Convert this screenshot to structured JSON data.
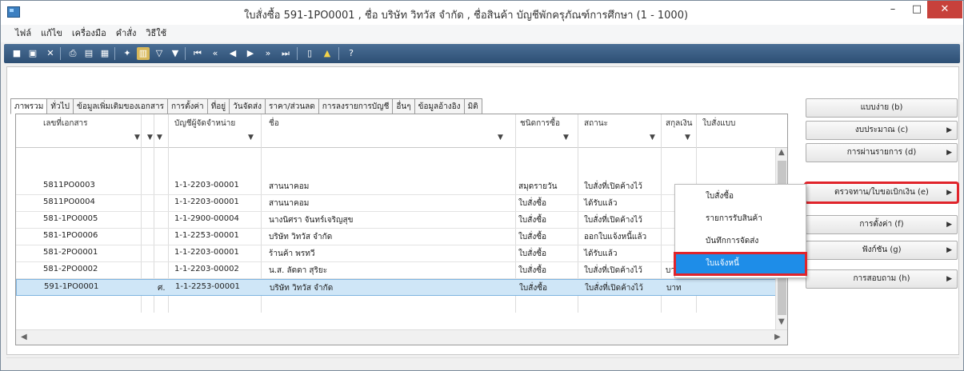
{
  "window": {
    "title": "ใบสั่งซื้อ 591-1PO0001 , ชื่อ บริษัท วิทวัส จำกัด , ชื่อสินค้า บัญชีพักครุภัณฑ์การศึกษา (1 - 1000)",
    "min": "–",
    "max": "□",
    "close": "✕"
  },
  "menu": [
    "ไฟล์",
    "แก้ไข",
    "เครื่องมือ",
    "คำสั่ง",
    "วิธีใช้"
  ],
  "tabs": [
    "ภาพรวม",
    "ทั่วไป",
    "ข้อมูลเพิ่มเติมของเอกสาร",
    "การตั้งค่า",
    "ที่อยู่",
    "วันจัดส่ง",
    "ราคา/ส่วนลด",
    "การลงรายการบัญชี",
    "อื่นๆ",
    "ข้อมูลอ้างอิง",
    "มิติ"
  ],
  "grid": {
    "headers": {
      "doc_no": "เลขที่เอกสาร",
      "vendor_account": "บัญชีผู้จัดจำหน่าย",
      "name": "ชื่อ",
      "purchase_type": "ชนิดการซื้อ",
      "status": "สถานะ",
      "currency": "สกุลเงิน",
      "po_type": "ใบสั่งแบบ"
    },
    "filter_arrow": "▼",
    "rows": [
      {
        "doc_no": "5811PO0003",
        "mark": "",
        "vendor_account": "1-1-2203-00001",
        "name": "สานนาคอม",
        "purchase_type": "สมุดรายวัน",
        "status": "ใบสั่งที่เปิดค้างไว้",
        "currency": "",
        "selected": false
      },
      {
        "doc_no": "5811PO0004",
        "mark": "",
        "vendor_account": "1-1-2203-00001",
        "name": "สานนาคอม",
        "purchase_type": "ใบสั่งซื้อ",
        "status": "ได้รับแล้ว",
        "currency": "",
        "selected": false
      },
      {
        "doc_no": "581-1PO0005",
        "mark": "",
        "vendor_account": "1-1-2900-00004",
        "name": "นางนิศรา จันทร์เจริญสุข",
        "purchase_type": "ใบสั่งซื้อ",
        "status": "ใบสั่งที่เปิดค้างไว้",
        "currency": "",
        "selected": false
      },
      {
        "doc_no": "581-1PO0006",
        "mark": "",
        "vendor_account": "1-1-2253-00001",
        "name": "บริษัท วิทวัส จำกัด",
        "purchase_type": "ใบสั่งซื้อ",
        "status": "ออกใบแจ้งหนี้แล้ว",
        "currency": "",
        "selected": false
      },
      {
        "doc_no": "581-2PO0001",
        "mark": "",
        "vendor_account": "1-1-2203-00001",
        "name": "ร้านค้า พรทวี",
        "purchase_type": "ใบสั่งซื้อ",
        "status": "ได้รับแล้ว",
        "currency": "",
        "selected": false
      },
      {
        "doc_no": "581-2PO0002",
        "mark": "",
        "vendor_account": "1-1-2203-00002",
        "name": "น.ส. ลัดดา สุริยะ",
        "purchase_type": "ใบสั่งซื้อ",
        "status": "ใบสั่งที่เปิดค้างไว้",
        "currency": "บาท",
        "selected": false
      },
      {
        "doc_no": "591-1PO0001",
        "mark": "ศ.",
        "vendor_account": "1-1-2253-00001",
        "name": "บริษัท วิทวัส จำกัด",
        "purchase_type": "ใบสั่งซื้อ",
        "status": "ใบสั่งที่เปิดค้างไว้",
        "currency": "บาท",
        "selected": true
      }
    ]
  },
  "side_buttons": [
    {
      "label": "แบบง่าย (b)",
      "arrow": ""
    },
    {
      "label": "งบประมาณ (c)",
      "arrow": "▶"
    },
    {
      "label": "การผ่านรายการ (d)",
      "arrow": "▶"
    },
    {
      "label": "ตรวจทาน/ใบขอเบิกเงิน (e)",
      "arrow": "▶"
    },
    {
      "label": "การตั้งค่า (f)",
      "arrow": "▶"
    },
    {
      "label": "ฟังก์ชัน (g)",
      "arrow": "▶"
    },
    {
      "label": "การสอบถาม (h)",
      "arrow": "▶"
    }
  ],
  "context_menu": [
    "ใบสั่งซื้อ",
    "รายการรับสินค้า",
    "บันทึกการจัดส่ง",
    "ใบแจ้งหนี้"
  ],
  "colors": {
    "accent": "#1e8de8",
    "highlight": "#e0242b",
    "toolbar": "#2d4f74"
  }
}
